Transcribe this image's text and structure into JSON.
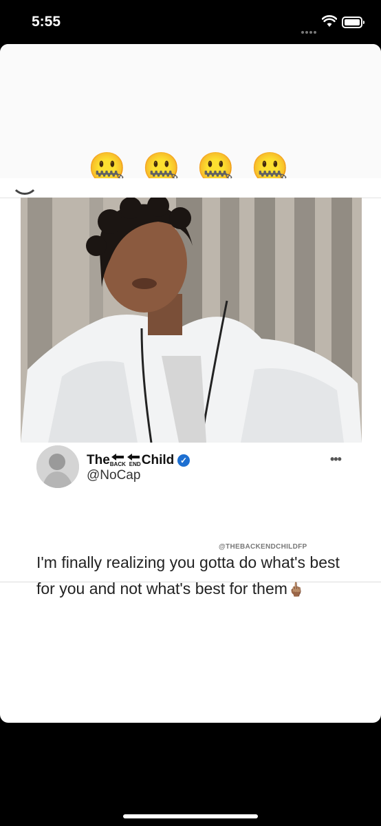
{
  "status": {
    "time": "5:55"
  },
  "reaction": {
    "emojis": [
      "🤐",
      "🤐",
      "🤐",
      "🤐"
    ]
  },
  "tweet": {
    "display_name_prefix": "The",
    "logo_word_1": "BACK",
    "logo_word_2": "END",
    "display_name_suffix": "Child",
    "handle": "@NoCap",
    "watermark": "@THEBACKENDCHILDFP",
    "text": "I'm finally realizing you gotta do what's best for you and not what's best for them",
    "text_emoji": "🖕🏽"
  },
  "colors": {
    "verified": "#1d6fd1",
    "background": "#000000",
    "sheet": "#ffffff"
  },
  "icons": [
    "wifi-icon",
    "battery-icon",
    "verified-icon",
    "more-icon"
  ]
}
